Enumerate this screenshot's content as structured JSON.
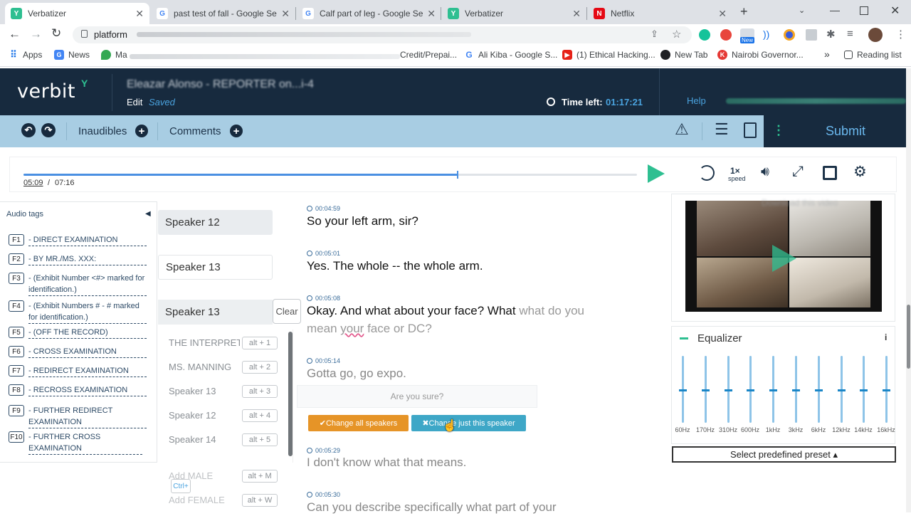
{
  "browser": {
    "tabs": [
      {
        "title": "Verbatizer",
        "favicon_color": "#2ebf91",
        "favicon_text": "Y",
        "active": true
      },
      {
        "title": "past test of fall - Google Sea",
        "favicon_color": "#4285f4",
        "favicon_text": "G",
        "active": false
      },
      {
        "title": "Calf part of leg - Google Sear",
        "favicon_color": "#4285f4",
        "favicon_text": "G",
        "active": false
      },
      {
        "title": "Verbatizer",
        "favicon_color": "#2ebf91",
        "favicon_text": "Y",
        "active": false
      },
      {
        "title": "Netflix",
        "favicon_color": "#e50914",
        "favicon_text": "N",
        "active": false
      }
    ],
    "new_tab": "+",
    "address": "platform",
    "bookmarks": {
      "apps": "Apps",
      "news": "News",
      "ma": "Ma",
      "credit": "Credit/Prepai...",
      "alikiba": "Ali Kiba - Google S...",
      "ethical": "(1) Ethical Hacking...",
      "newtab": "New Tab",
      "nairobi": "Nairobi Governor...",
      "more": "»",
      "reading": "Reading list"
    },
    "ext_badge": "New"
  },
  "app": {
    "logo": "verbit",
    "job_title": "Eleazar Alonso - REPORTER on...i-4",
    "edit": "Edit",
    "saved": "Saved",
    "time_left_label": "Time left:",
    "time_left": "01:17:21",
    "help": "Help",
    "inaudibles": "Inaudibles",
    "comments": "Comments",
    "submit": "Submit",
    "accent": "#2ebf91",
    "header_bg": "#172a3e"
  },
  "player": {
    "current": "05:09",
    "separator": "/",
    "duration": "07:16",
    "progress": 0.708,
    "speed": "1×",
    "speed_label": "speed"
  },
  "audio_tags": {
    "title": "Audio tags",
    "items": [
      {
        "key": "F1",
        "text": "- DIRECT EXAMINATION"
      },
      {
        "key": "F2",
        "text": "- BY MR./MS. XXX:"
      },
      {
        "key": "F3",
        "text": "- (Exhibit Number <#> marked for identification.)"
      },
      {
        "key": "F4",
        "text": "- (Exhibit Numbers # - # marked for identification.)"
      },
      {
        "key": "F5",
        "text": "- (OFF THE RECORD)"
      },
      {
        "key": "F6",
        "text": "- CROSS EXAMINATION"
      },
      {
        "key": "F7",
        "text": "- REDIRECT EXAMINATION"
      },
      {
        "key": "F8",
        "text": "- RECROSS EXAMINATION"
      },
      {
        "key": "F9",
        "text": "- FURTHER REDIRECT EXAMINATION"
      },
      {
        "key": "F10",
        "text": "- FURTHER CROSS EXAMINATION"
      }
    ]
  },
  "transcript": {
    "speakers": [
      "Speaker 12",
      "Speaker 13",
      "Speaker 13"
    ],
    "clear": "Clear",
    "segments": [
      {
        "time": "00:04:59",
        "text": "So your left arm, sir?"
      },
      {
        "time": "00:05:01",
        "text": "Yes. The whole -- the whole arm."
      },
      {
        "time": "00:05:08",
        "text_dark": "Okay. And what about your face? What",
        "text_light": "what do you mean",
        "text_your": "your",
        "text_rest": "face or DC?"
      },
      {
        "time": "00:05:14",
        "text": "Gotta go, go expo."
      },
      {
        "time": "00:05:29",
        "text": "I don't know what that means."
      },
      {
        "time": "00:05:30",
        "text": "Can you describe specifically what part of your"
      }
    ],
    "confirm": "Are you sure?",
    "change_all": "✔Change all speakers",
    "change_this": "✖Change just this speaker"
  },
  "speaker_dropdown": [
    {
      "name": "THE INTERPRET...",
      "key": "alt + 1"
    },
    {
      "name": "MS. MANNING",
      "key": "alt + 2"
    },
    {
      "name": "Speaker 13",
      "key": "alt + 3"
    },
    {
      "name": "Speaker 12",
      "key": "alt + 4"
    },
    {
      "name": "Speaker 14",
      "key": "alt + 5"
    },
    {
      "name": "Add MALE",
      "key": "alt + M"
    },
    {
      "name": "Add FEMALE",
      "key": "alt + W"
    }
  ],
  "ctrl_hint": "Ctrl+",
  "video": {
    "download": "Download this video"
  },
  "equalizer": {
    "title": "Equalizer",
    "info": "i",
    "bands": [
      {
        "label": "60Hz",
        "level": 0.5
      },
      {
        "label": "170Hz",
        "level": 0.5
      },
      {
        "label": "310Hz",
        "level": 0.5
      },
      {
        "label": "600Hz",
        "level": 0.5
      },
      {
        "label": "1kHz",
        "level": 0.5
      },
      {
        "label": "3kHz",
        "level": 0.5
      },
      {
        "label": "6kHz",
        "level": 0.5
      },
      {
        "label": "12kHz",
        "level": 0.5
      },
      {
        "label": "14kHz",
        "level": 0.5
      },
      {
        "label": "16kHz",
        "level": 0.5
      }
    ],
    "preset": "Select predefined preset ▴"
  }
}
